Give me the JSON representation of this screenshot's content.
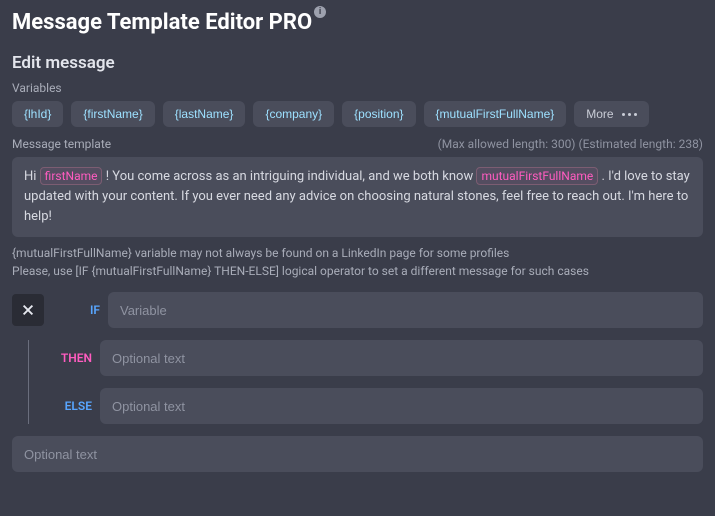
{
  "header": {
    "title": "Message Template Editor PRO",
    "info_glyph": "i"
  },
  "section": {
    "edit_title": "Edit message",
    "variables_label": "Variables"
  },
  "chips": [
    "{lhId}",
    "{firstName}",
    "{lastName}",
    "{company}",
    "{position}",
    "{mutualFirstFullName}"
  ],
  "chips_more": "More",
  "template_label": "Message template",
  "template_meta": "(Max allowed length: 300) (Estimated length: 238)",
  "template": {
    "part1": "Hi ",
    "var1": "firstName",
    "part2": "! You come across as an intriguing individual, and we both know ",
    "var2": "mutualFirstFullName",
    "part3": ". I'd love to stay updated with your content. If you ever need any advice on choosing natural stones, feel free to reach out. I'm here to help!"
  },
  "notes": {
    "line1": "{mutualFirstFullName} variable may not always be found on a LinkedIn page for some profiles",
    "line2": "Please, use [IF {mutualFirstFullName} THEN-ELSE] logical operator to set a different message for such cases"
  },
  "logic": {
    "if_label": "IF",
    "then_label": "THEN",
    "else_label": "ELSE",
    "if_placeholder": "Variable",
    "then_placeholder": "Optional text",
    "else_placeholder": "Optional text"
  },
  "bottom_placeholder": "Optional text"
}
